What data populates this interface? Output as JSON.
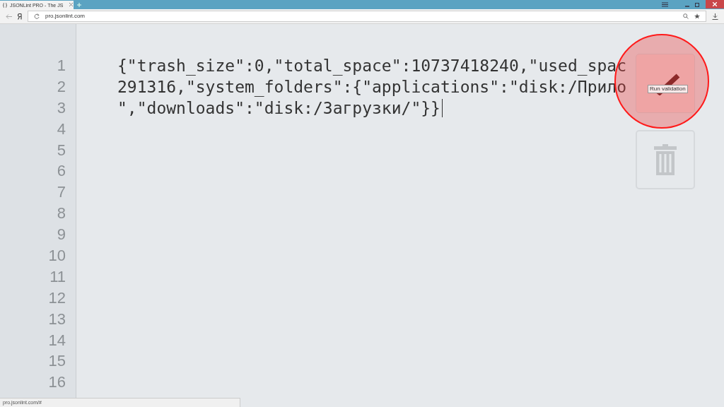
{
  "browser": {
    "tab": {
      "title": "JSONLint PRO - The JS",
      "selected": true
    },
    "address": "pro.jsonlint.com"
  },
  "editor": {
    "line_numbers": [
      "1",
      "2",
      "3",
      "4",
      "5",
      "6",
      "7",
      "8",
      "9",
      "10",
      "11",
      "12",
      "13",
      "14",
      "15",
      "16"
    ],
    "lines": [
      "{\"trash_size\":0,\"total_space\":10737418240,\"used_spac",
      "291316,\"system_folders\":{\"applications\":\"disk:/Прило",
      "\",\"downloads\":\"disk:/Загрузки/\"}}"
    ]
  },
  "actions": {
    "validate_tooltip": "Run validation"
  },
  "status_bar": "pro.jsonlint.com/#"
}
